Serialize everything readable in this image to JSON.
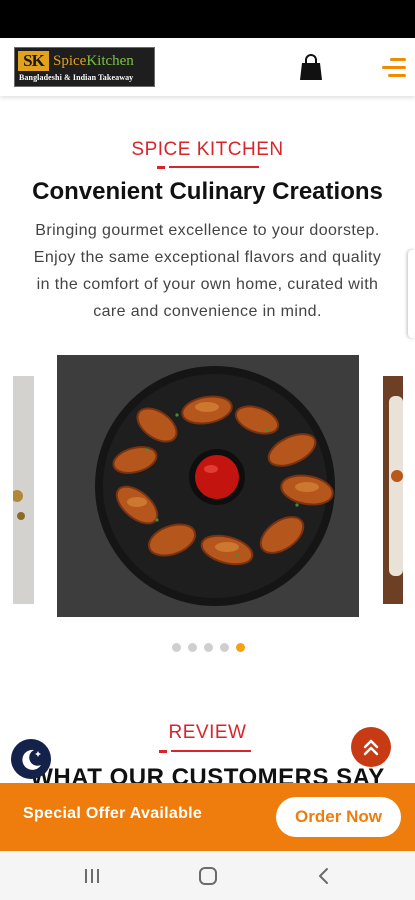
{
  "header": {
    "logo": {
      "mark": "SK",
      "name_part1": "Spice",
      "name_part2": "Kitchen",
      "tagline": "Bangladeshi & Indian Takeaway"
    },
    "icons": {
      "cart": "shopping-bag-icon",
      "menu": "hamburger-menu-icon"
    }
  },
  "hero": {
    "eyebrow": "SPICE KITCHEN",
    "title": "Convenient Culinary Creations",
    "description_lines": [
      "Bringing gourmet excellence to your doorstep.",
      "Enjoy the same exceptional flavors and quality",
      "in the comfort of your own home, curated with",
      "care and convenience in mind."
    ]
  },
  "carousel": {
    "slide_count": 5,
    "active_index": 4
  },
  "review": {
    "eyebrow": "REVIEW",
    "heading": "WHAT OUR CUSTOMERS SAY"
  },
  "offer_bar": {
    "text": "Special Offer Available",
    "button": "Order Now"
  },
  "floating": {
    "theme_icon": "moon-icon",
    "scroll_top_icon": "double-chevron-up-icon"
  },
  "nav": {
    "icons": [
      "recent-apps-icon",
      "home-icon",
      "back-icon"
    ]
  },
  "colors": {
    "accent_red": "#d9252a",
    "accent_orange": "#ee7d0e",
    "dot_active": "#f3a012"
  }
}
